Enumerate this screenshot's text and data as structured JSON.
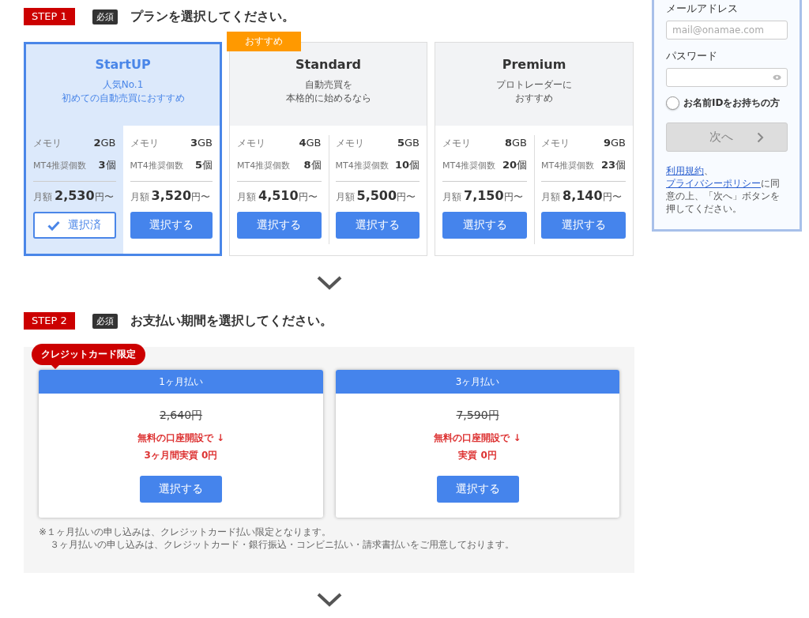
{
  "step1": {
    "step": "STEP 1",
    "required": "必須",
    "title": "プランを選択してください。"
  },
  "plans": [
    {
      "name": "StartUP",
      "selected": true,
      "description": [
        "人気No.1",
        "初めての自動売買におすすめ"
      ],
      "variants": [
        {
          "memory_label": "メモリ",
          "memory": "**2**GB",
          "mt4_label": "MT4推奨個数",
          "mt4": "**3**個",
          "price_label": "月額",
          "price": "2,530",
          "price_suffix": "円〜",
          "button": "選択済",
          "selected": true
        },
        {
          "memory_label": "メモリ",
          "memory": "**3**GB",
          "mt4_label": "MT4推奨個数",
          "mt4": "**5**個",
          "price_label": "月額",
          "price": "3,520",
          "price_suffix": "円〜",
          "button": "選択する",
          "selected": false
        }
      ]
    },
    {
      "name": "Standard",
      "selected": false,
      "badge": "おすすめ",
      "description": [
        "自動売買を",
        "本格的に始めるなら"
      ],
      "variants": [
        {
          "memory_label": "メモリ",
          "memory": "**4**GB",
          "mt4_label": "MT4推奨個数",
          "mt4": "**8**個",
          "price_label": "月額",
          "price": "4,510",
          "price_suffix": "円〜",
          "button": "選択する",
          "selected": false
        },
        {
          "memory_label": "メモリ",
          "memory": "**5**GB",
          "mt4_label": "MT4推奨個数",
          "mt4": "**10**個",
          "price_label": "月額",
          "price": "5,500",
          "price_suffix": "円〜",
          "button": "選択する",
          "selected": false
        }
      ]
    },
    {
      "name": "Premium",
      "selected": false,
      "description": [
        "プロトレーダーに",
        "おすすめ"
      ],
      "variants": [
        {
          "memory_label": "メモリ",
          "memory": "**8**GB",
          "mt4_label": "MT4推奨個数",
          "mt4": "**20**個",
          "price_label": "月額",
          "price": "7,150",
          "price_suffix": "円〜",
          "button": "選択する",
          "selected": false
        },
        {
          "memory_label": "メモリ",
          "memory": "**9**GB",
          "mt4_label": "MT4推奨個数",
          "mt4": "**23**個",
          "price_label": "月額",
          "price": "8,140",
          "price_suffix": "円〜",
          "button": "選択する",
          "selected": false
        }
      ]
    }
  ],
  "step2": {
    "step": "STEP 2",
    "required": "必須",
    "title": "お支払い期間を選択してください。"
  },
  "payment": {
    "tag": "クレジットカード限定",
    "options": [
      {
        "title": "1ヶ月払い",
        "original_price": "2,640円",
        "offer": [
          "無料の口座開設で ↓",
          "3ヶ月間実質 0円"
        ],
        "button": "選択する"
      },
      {
        "title": "3ヶ月払い",
        "original_price": "7,590円",
        "offer": [
          "無料の口座開設で ↓",
          "実質 0円"
        ],
        "button": "選択する"
      }
    ],
    "notes": [
      "※１ヶ月払いの申し込みは、クレジットカード払い限定となります。",
      "３ヶ月払いの申し込みは、クレジットカード・銀行振込・コンビニ払い・請求書払いをご用意しております。"
    ]
  },
  "login": {
    "email_label": "メールアドレス",
    "email_placeholder": "mail@onamae.com",
    "password_label": "パスワード",
    "radio": {
      "label": "お名前IDをお持ちの方",
      "checked": false
    },
    "next_button": {
      "label": "次へ",
      "disabled": true
    },
    "terms": [
      {
        "kind": "link",
        "text": "利用規約"
      },
      {
        "kind": "text",
        "text": "、"
      },
      {
        "kind": "link",
        "text": "プライバシーポリシー"
      },
      {
        "kind": "text",
        "text": "に同意の上、「次へ」ボタンを押してください。"
      }
    ]
  }
}
